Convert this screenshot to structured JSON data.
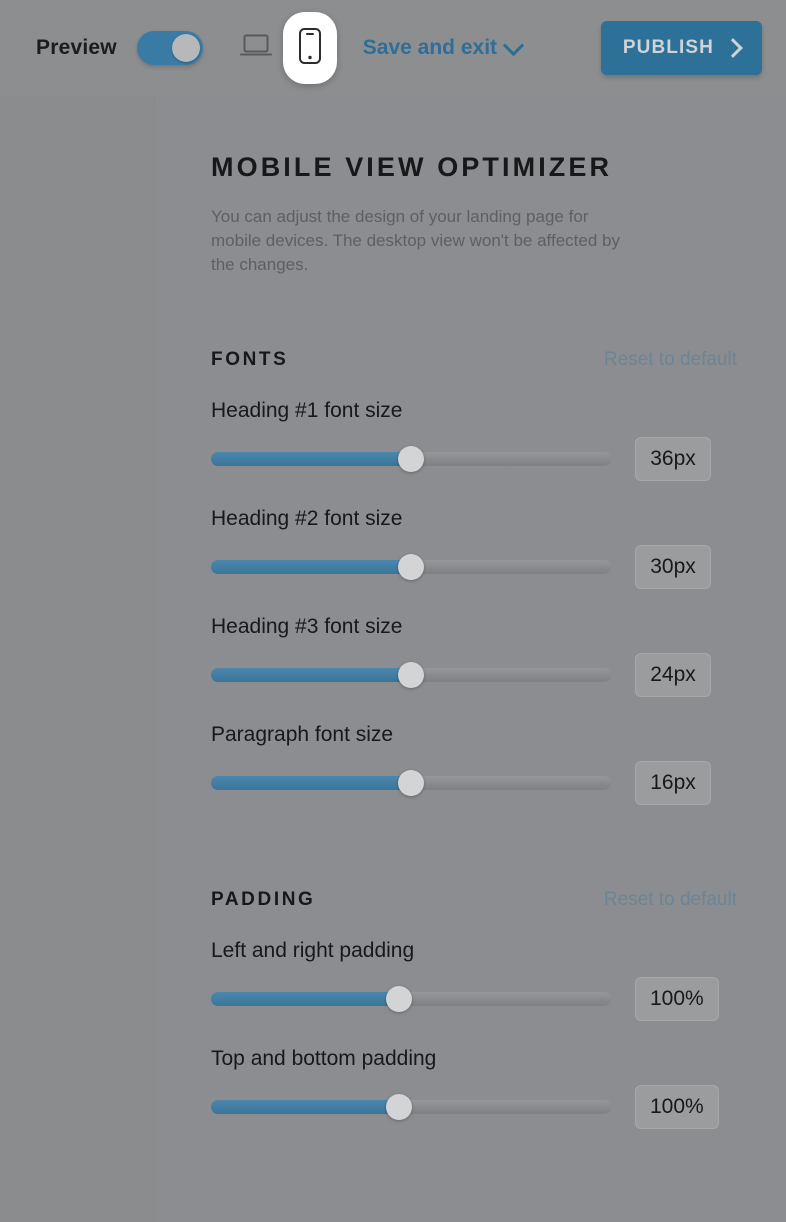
{
  "toolbar": {
    "preview_label": "Preview",
    "preview_toggle_state": "on",
    "devices": [
      {
        "name": "desktop-view",
        "icon": "laptop-icon",
        "selected": false
      },
      {
        "name": "mobile-view",
        "icon": "phone-icon",
        "selected": true
      }
    ],
    "save_and_exit_label": "Save and exit",
    "save_and_exit_icon": "chevron-down-icon",
    "publish_label": "PUBLISH",
    "publish_icon": "chevron-right-icon",
    "accent_color": "#2d7098",
    "toggle_color": "#3a7ba5"
  },
  "panel": {
    "title": "MOBILE VIEW OPTIMIZER",
    "description": "You can adjust the design of your landing page for mobile devices. The desktop view won't be affected by the changes.",
    "sections": [
      {
        "title": "FONTS",
        "reset_label": "Reset to default",
        "fields": [
          {
            "label": "Heading #1 font size",
            "value": "36px",
            "percent": 50
          },
          {
            "label": "Heading #2 font size",
            "value": "30px",
            "percent": 50
          },
          {
            "label": "Heading #3 font size",
            "value": "24px",
            "percent": 50
          },
          {
            "label": "Paragraph font size",
            "value": "16px",
            "percent": 50
          }
        ]
      },
      {
        "title": "PADDING",
        "reset_label": "Reset to default",
        "fields": [
          {
            "label": "Left and right padding",
            "value": "100%",
            "percent": 47
          },
          {
            "label": "Top and bottom padding",
            "value": "100%",
            "percent": 47
          }
        ]
      }
    ]
  }
}
